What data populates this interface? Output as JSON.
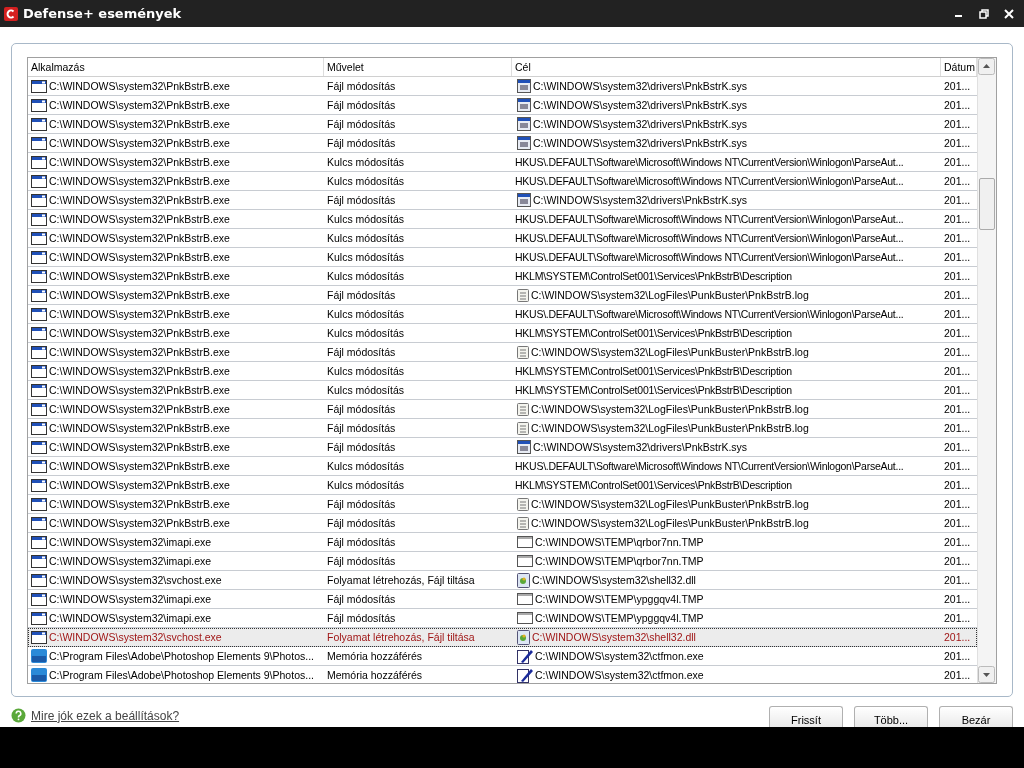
{
  "window": {
    "title": "Defense+ események"
  },
  "table": {
    "columns": [
      "Alkalmazás",
      "Művelet",
      "Cél",
      "Dátum"
    ],
    "rows": [
      {
        "app": {
          "kind": "window",
          "path": "C:\\WINDOWS\\system32\\PnkBstrB.exe"
        },
        "action": "Fájl módosítás",
        "target": {
          "kind": "sys",
          "path": "C:\\WINDOWS\\system32\\drivers\\PnkBstrK.sys"
        },
        "date": "201...",
        "selected": false
      },
      {
        "app": {
          "kind": "window",
          "path": "C:\\WINDOWS\\system32\\PnkBstrB.exe"
        },
        "action": "Fájl módosítás",
        "target": {
          "kind": "sys",
          "path": "C:\\WINDOWS\\system32\\drivers\\PnkBstrK.sys"
        },
        "date": "201...",
        "selected": false
      },
      {
        "app": {
          "kind": "window",
          "path": "C:\\WINDOWS\\system32\\PnkBstrB.exe"
        },
        "action": "Fájl módosítás",
        "target": {
          "kind": "sys",
          "path": "C:\\WINDOWS\\system32\\drivers\\PnkBstrK.sys"
        },
        "date": "201...",
        "selected": false
      },
      {
        "app": {
          "kind": "window",
          "path": "C:\\WINDOWS\\system32\\PnkBstrB.exe"
        },
        "action": "Fájl módosítás",
        "target": {
          "kind": "sys",
          "path": "C:\\WINDOWS\\system32\\drivers\\PnkBstrK.sys"
        },
        "date": "201...",
        "selected": false
      },
      {
        "app": {
          "kind": "window",
          "path": "C:\\WINDOWS\\system32\\PnkBstrB.exe"
        },
        "action": "Kulcs módosítás",
        "target": {
          "kind": "key",
          "path": "HKUS\\.DEFAULT\\Software\\Microsoft\\Windows NT\\CurrentVersion\\Winlogon\\ParseAut..."
        },
        "date": "201...",
        "selected": false
      },
      {
        "app": {
          "kind": "window",
          "path": "C:\\WINDOWS\\system32\\PnkBstrB.exe"
        },
        "action": "Kulcs módosítás",
        "target": {
          "kind": "key",
          "path": "HKUS\\.DEFAULT\\Software\\Microsoft\\Windows NT\\CurrentVersion\\Winlogon\\ParseAut..."
        },
        "date": "201...",
        "selected": false
      },
      {
        "app": {
          "kind": "window",
          "path": "C:\\WINDOWS\\system32\\PnkBstrB.exe"
        },
        "action": "Fájl módosítás",
        "target": {
          "kind": "sys",
          "path": "C:\\WINDOWS\\system32\\drivers\\PnkBstrK.sys"
        },
        "date": "201...",
        "selected": false
      },
      {
        "app": {
          "kind": "window",
          "path": "C:\\WINDOWS\\system32\\PnkBstrB.exe"
        },
        "action": "Kulcs módosítás",
        "target": {
          "kind": "key",
          "path": "HKUS\\.DEFAULT\\Software\\Microsoft\\Windows NT\\CurrentVersion\\Winlogon\\ParseAut..."
        },
        "date": "201...",
        "selected": false
      },
      {
        "app": {
          "kind": "window",
          "path": "C:\\WINDOWS\\system32\\PnkBstrB.exe"
        },
        "action": "Kulcs módosítás",
        "target": {
          "kind": "key",
          "path": "HKUS\\.DEFAULT\\Software\\Microsoft\\Windows NT\\CurrentVersion\\Winlogon\\ParseAut..."
        },
        "date": "201...",
        "selected": false
      },
      {
        "app": {
          "kind": "window",
          "path": "C:\\WINDOWS\\system32\\PnkBstrB.exe"
        },
        "action": "Kulcs módosítás",
        "target": {
          "kind": "key",
          "path": "HKUS\\.DEFAULT\\Software\\Microsoft\\Windows NT\\CurrentVersion\\Winlogon\\ParseAut..."
        },
        "date": "201...",
        "selected": false
      },
      {
        "app": {
          "kind": "window",
          "path": "C:\\WINDOWS\\system32\\PnkBstrB.exe"
        },
        "action": "Kulcs módosítás",
        "target": {
          "kind": "key",
          "path": "HKLM\\SYSTEM\\ControlSet001\\Services\\PnkBstrB\\Description"
        },
        "date": "201...",
        "selected": false
      },
      {
        "app": {
          "kind": "window",
          "path": "C:\\WINDOWS\\system32\\PnkBstrB.exe"
        },
        "action": "Fájl módosítás",
        "target": {
          "kind": "log",
          "path": "C:\\WINDOWS\\system32\\LogFiles\\PunkBuster\\PnkBstrB.log"
        },
        "date": "201...",
        "selected": false
      },
      {
        "app": {
          "kind": "window",
          "path": "C:\\WINDOWS\\system32\\PnkBstrB.exe"
        },
        "action": "Kulcs módosítás",
        "target": {
          "kind": "key",
          "path": "HKUS\\.DEFAULT\\Software\\Microsoft\\Windows NT\\CurrentVersion\\Winlogon\\ParseAut..."
        },
        "date": "201...",
        "selected": false
      },
      {
        "app": {
          "kind": "window",
          "path": "C:\\WINDOWS\\system32\\PnkBstrB.exe"
        },
        "action": "Kulcs módosítás",
        "target": {
          "kind": "key",
          "path": "HKLM\\SYSTEM\\ControlSet001\\Services\\PnkBstrB\\Description"
        },
        "date": "201...",
        "selected": false
      },
      {
        "app": {
          "kind": "window",
          "path": "C:\\WINDOWS\\system32\\PnkBstrB.exe"
        },
        "action": "Fájl módosítás",
        "target": {
          "kind": "log",
          "path": "C:\\WINDOWS\\system32\\LogFiles\\PunkBuster\\PnkBstrB.log"
        },
        "date": "201...",
        "selected": false
      },
      {
        "app": {
          "kind": "window",
          "path": "C:\\WINDOWS\\system32\\PnkBstrB.exe"
        },
        "action": "Kulcs módosítás",
        "target": {
          "kind": "key",
          "path": "HKLM\\SYSTEM\\ControlSet001\\Services\\PnkBstrB\\Description"
        },
        "date": "201...",
        "selected": false
      },
      {
        "app": {
          "kind": "window",
          "path": "C:\\WINDOWS\\system32\\PnkBstrB.exe"
        },
        "action": "Kulcs módosítás",
        "target": {
          "kind": "key",
          "path": "HKLM\\SYSTEM\\ControlSet001\\Services\\PnkBstrB\\Description"
        },
        "date": "201...",
        "selected": false
      },
      {
        "app": {
          "kind": "window",
          "path": "C:\\WINDOWS\\system32\\PnkBstrB.exe"
        },
        "action": "Fájl módosítás",
        "target": {
          "kind": "log",
          "path": "C:\\WINDOWS\\system32\\LogFiles\\PunkBuster\\PnkBstrB.log"
        },
        "date": "201...",
        "selected": false
      },
      {
        "app": {
          "kind": "window",
          "path": "C:\\WINDOWS\\system32\\PnkBstrB.exe"
        },
        "action": "Fájl módosítás",
        "target": {
          "kind": "log",
          "path": "C:\\WINDOWS\\system32\\LogFiles\\PunkBuster\\PnkBstrB.log"
        },
        "date": "201...",
        "selected": false
      },
      {
        "app": {
          "kind": "window",
          "path": "C:\\WINDOWS\\system32\\PnkBstrB.exe"
        },
        "action": "Fájl módosítás",
        "target": {
          "kind": "sys",
          "path": "C:\\WINDOWS\\system32\\drivers\\PnkBstrK.sys"
        },
        "date": "201...",
        "selected": false
      },
      {
        "app": {
          "kind": "window",
          "path": "C:\\WINDOWS\\system32\\PnkBstrB.exe"
        },
        "action": "Kulcs módosítás",
        "target": {
          "kind": "key",
          "path": "HKUS\\.DEFAULT\\Software\\Microsoft\\Windows NT\\CurrentVersion\\Winlogon\\ParseAut..."
        },
        "date": "201...",
        "selected": false
      },
      {
        "app": {
          "kind": "window",
          "path": "C:\\WINDOWS\\system32\\PnkBstrB.exe"
        },
        "action": "Kulcs módosítás",
        "target": {
          "kind": "key",
          "path": "HKLM\\SYSTEM\\ControlSet001\\Services\\PnkBstrB\\Description"
        },
        "date": "201...",
        "selected": false
      },
      {
        "app": {
          "kind": "window",
          "path": "C:\\WINDOWS\\system32\\PnkBstrB.exe"
        },
        "action": "Fájl módosítás",
        "target": {
          "kind": "log",
          "path": "C:\\WINDOWS\\system32\\LogFiles\\PunkBuster\\PnkBstrB.log"
        },
        "date": "201...",
        "selected": false
      },
      {
        "app": {
          "kind": "window",
          "path": "C:\\WINDOWS\\system32\\PnkBstrB.exe"
        },
        "action": "Fájl módosítás",
        "target": {
          "kind": "log",
          "path": "C:\\WINDOWS\\system32\\LogFiles\\PunkBuster\\PnkBstrB.log"
        },
        "date": "201...",
        "selected": false
      },
      {
        "app": {
          "kind": "window",
          "path": "C:\\WINDOWS\\system32\\imapi.exe"
        },
        "action": "Fájl módosítás",
        "target": {
          "kind": "tmp",
          "path": "C:\\WINDOWS\\TEMP\\qrbor7nn.TMP"
        },
        "date": "201...",
        "selected": false
      },
      {
        "app": {
          "kind": "window",
          "path": "C:\\WINDOWS\\system32\\imapi.exe"
        },
        "action": "Fájl módosítás",
        "target": {
          "kind": "tmp",
          "path": "C:\\WINDOWS\\TEMP\\qrbor7nn.TMP"
        },
        "date": "201...",
        "selected": false
      },
      {
        "app": {
          "kind": "window",
          "path": "C:\\WINDOWS\\system32\\svchost.exe"
        },
        "action": "Folyamat létrehozás, Fájl tiltása",
        "target": {
          "kind": "dll",
          "path": "C:\\WINDOWS\\system32\\shell32.dll"
        },
        "date": "201...",
        "selected": false
      },
      {
        "app": {
          "kind": "window",
          "path": "C:\\WINDOWS\\system32\\imapi.exe"
        },
        "action": "Fájl módosítás",
        "target": {
          "kind": "tmp",
          "path": "C:\\WINDOWS\\TEMP\\ypggqv4l.TMP"
        },
        "date": "201...",
        "selected": false
      },
      {
        "app": {
          "kind": "window",
          "path": "C:\\WINDOWS\\system32\\imapi.exe"
        },
        "action": "Fájl módosítás",
        "target": {
          "kind": "tmp",
          "path": "C:\\WINDOWS\\TEMP\\ypggqv4l.TMP"
        },
        "date": "201...",
        "selected": false
      },
      {
        "app": {
          "kind": "window",
          "path": "C:\\WINDOWS\\system32\\svchost.exe"
        },
        "action": "Folyamat létrehozás, Fájl tiltása",
        "target": {
          "kind": "dll",
          "path": "C:\\WINDOWS\\system32\\shell32.dll"
        },
        "date": "201...",
        "selected": true
      },
      {
        "app": {
          "kind": "pse",
          "path": "C:\\Program Files\\Adobe\\Photoshop Elements 9\\Photos..."
        },
        "action": "Memória hozzáférés",
        "target": {
          "kind": "pen",
          "path": "C:\\WINDOWS\\system32\\ctfmon.exe"
        },
        "date": "201...",
        "selected": false
      },
      {
        "app": {
          "kind": "pse",
          "path": "C:\\Program Files\\Adobe\\Photoshop Elements 9\\Photos..."
        },
        "action": "Memória hozzáférés",
        "target": {
          "kind": "pen",
          "path": "C:\\WINDOWS\\system32\\ctfmon.exe"
        },
        "date": "201...",
        "selected": false
      }
    ]
  },
  "help_link": "Mire jók ezek a beállítások?",
  "buttons": [
    "Frissít",
    "Több...",
    "Bezár"
  ]
}
